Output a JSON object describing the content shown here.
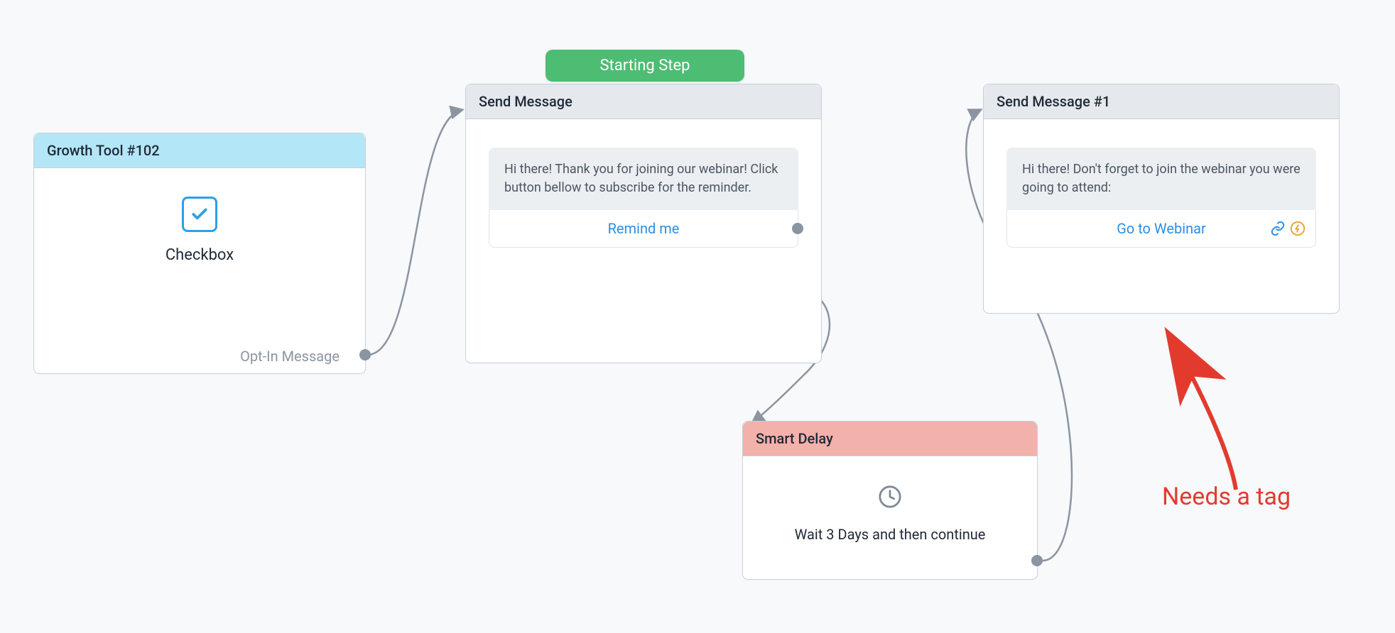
{
  "badge": {
    "starting": "Starting Step"
  },
  "nodes": {
    "growth": {
      "title": "Growth Tool #102",
      "type_label": "Checkbox",
      "out_label": "Opt-In Message"
    },
    "send1": {
      "title": "Send Message",
      "bubble": "Hi there! Thank you for joining our webinar! Click button bellow to subscribe for the reminder.",
      "button": "Remind me"
    },
    "delay": {
      "title": "Smart Delay",
      "text": "Wait 3 Days and then continue"
    },
    "send2": {
      "title": "Send Message #1",
      "bubble": "Hi there! Don't forget to join the webinar you were going to attend:",
      "button": "Go to Webinar"
    }
  },
  "annotation": {
    "text": "Needs a tag"
  }
}
